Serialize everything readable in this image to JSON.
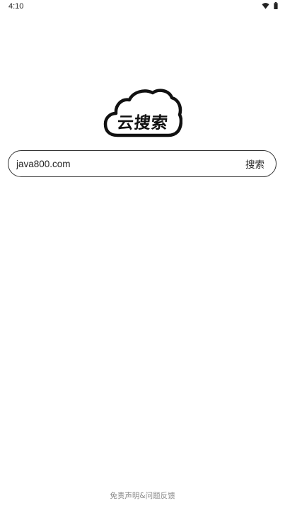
{
  "status_bar": {
    "time": "4:10",
    "icons": [
      "wifi-icon",
      "battery-icon"
    ]
  },
  "logo": {
    "text": "云搜索",
    "icon": "cloud-icon"
  },
  "search": {
    "value": "java800.com",
    "placeholder": "",
    "button_label": "搜索"
  },
  "footer": {
    "link_label": "免责声明&问题反馈"
  },
  "colors": {
    "background": "#ffffff",
    "text": "#222222",
    "border": "#333333",
    "footer_text": "#8a8a8a"
  }
}
